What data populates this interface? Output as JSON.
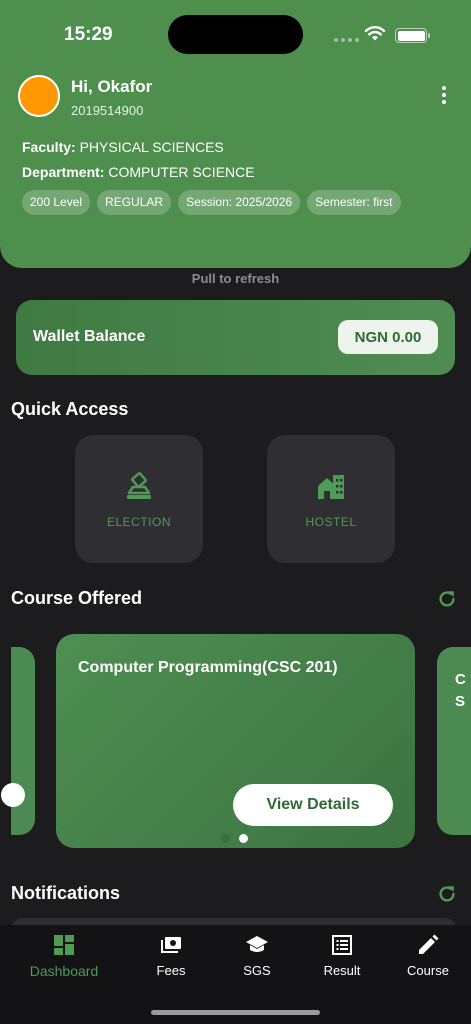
{
  "status_bar": {
    "time": "15:29"
  },
  "profile": {
    "greeting": "Hi, Okafor",
    "matric": "2019514900",
    "faculty_label": "Faculty:",
    "faculty_value": "PHYSICAL SCIENCES",
    "department_label": "Department:",
    "department_value": "COMPUTER SCIENCE",
    "chips": [
      "200 Level",
      "REGULAR",
      "Session: 2025/2026",
      "Semester: first"
    ],
    "avatar_color": "#ff9800"
  },
  "pull_hint": "Pull to refresh",
  "wallet": {
    "label": "Wallet Balance",
    "amount": "NGN 0.00"
  },
  "quick_access": {
    "title": "Quick Access",
    "items": [
      {
        "label": "ELECTION",
        "icon": "ballot-box-icon"
      },
      {
        "label": "HOSTEL",
        "icon": "hostel-building-icon"
      }
    ]
  },
  "courses": {
    "title": "Course Offered",
    "current": {
      "name": "Computer Programming(CSC 201)",
      "button": "View Details"
    },
    "next_card_peek": [
      "C",
      "S"
    ],
    "page_count": 2,
    "active_page": 2
  },
  "notifications": {
    "title": "Notifications"
  },
  "bottom_nav": {
    "items": [
      {
        "label": "Dashboard",
        "icon": "dashboard-grid-icon",
        "active": true
      },
      {
        "label": "Fees",
        "icon": "fees-money-icon",
        "active": false
      },
      {
        "label": "SGS",
        "icon": "graduation-cap-icon",
        "active": false
      },
      {
        "label": "Result",
        "icon": "result-list-icon",
        "active": false
      },
      {
        "label": "Course",
        "icon": "pencil-edit-icon",
        "active": false
      }
    ]
  },
  "colors": {
    "primary_green": "#4e8f4e",
    "accent_green": "#4f9a55",
    "background": "#1c1c1f"
  }
}
